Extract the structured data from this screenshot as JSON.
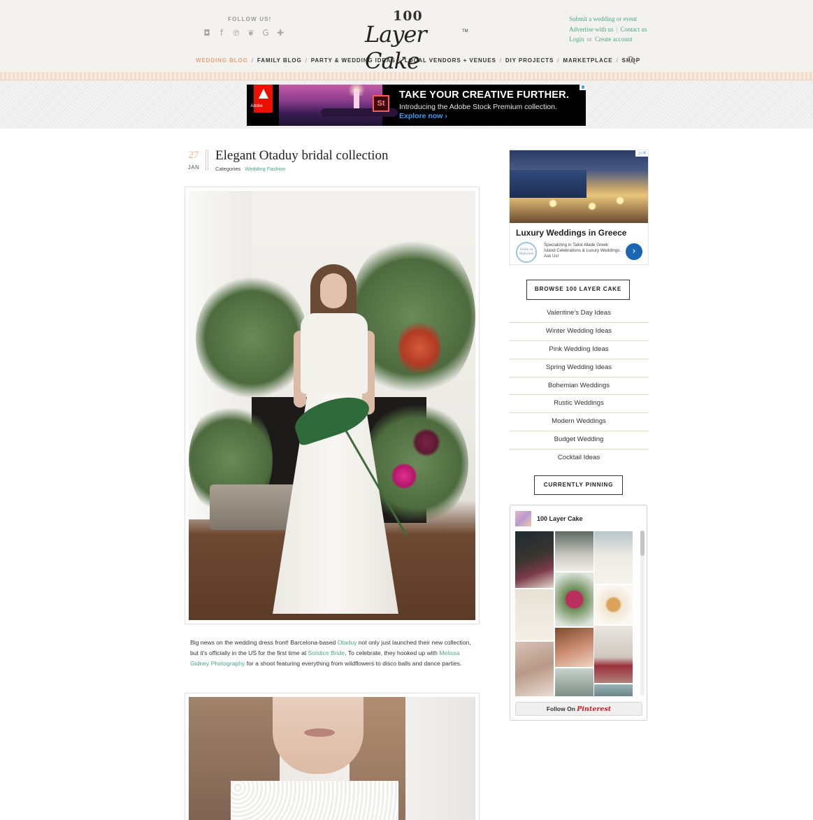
{
  "header": {
    "follow_label": "FOLLOW US!",
    "social_icons": [
      "instagram-icon",
      "facebook-icon",
      "pinterest-icon",
      "twitter-icon",
      "google-plus-icon",
      "plus-icon"
    ],
    "logo": {
      "number": "100",
      "script": "Layer Cake",
      "tm": "TM"
    },
    "links": {
      "submit": "Submit a wedding or event",
      "advertise": "Advertise with us",
      "separator": "|",
      "contact": "Contact us",
      "login": "Login",
      "or": "or",
      "create": "Create account"
    }
  },
  "nav": {
    "items": [
      "WEDDING BLOG",
      "FAMILY BLOG",
      "PARTY & WEDDING IDEAS",
      "LOCAL VENDORS + VENUES",
      "DIY PROJECTS",
      "MARKETPLACE",
      "SHOP"
    ],
    "separator": "/",
    "active_color": "#e8a178"
  },
  "top_ad": {
    "brand": "Adobe",
    "product_mark": "St",
    "headline": "TAKE YOUR CREATIVE FURTHER.",
    "subline": "Introducing the Adobe Stock Premium collection.",
    "cta": "Explore now ›"
  },
  "post": {
    "day": "27",
    "month": "JAN",
    "title": "Elegant Otaduy bridal collection",
    "categories_label": "Categories",
    "category": "Wedding Fashion",
    "body": {
      "t1": "Big news on the wedding dress front! Barcelona-based ",
      "l1": "Otaduy",
      "t2": " not only just launched their new collection, but it's officially in the US for the first time at ",
      "l2": "Solstice Bride",
      "t3": ". To celebrate, they hooked up with ",
      "l3": "Melissa Gidney Photography",
      "t4": " for a shoot featuring everything from wildflowers to disco balls and dance parties."
    },
    "link_color": "#4aa58a"
  },
  "sidebar": {
    "ad": {
      "title": "Luxury Weddings in Greece",
      "badge": "Smile in Mykonos",
      "description": "Specializing in Tailor-Made Greek Island Celebrations & Luxury Weddings. Ask Us!",
      "go_arrow": "›"
    },
    "browse_label": "BROWSE 100 LAYER CAKE",
    "browse_items": [
      "Valentine's Day Ideas",
      "Winter Wedding Ideas",
      "Pink Wedding Ideas",
      "Spring Wedding Ideas",
      "Bohemian Weddings",
      "Rustic Weddings",
      "Modern Weddings",
      "Budget Wedding",
      "Cocktail Ideas"
    ],
    "pinning_label": "CURRENTLY PINNING",
    "pinterest": {
      "account_name": "100 Layer Cake",
      "follow_prefix": "Follow On",
      "follow_brand": "Pinterest"
    }
  }
}
